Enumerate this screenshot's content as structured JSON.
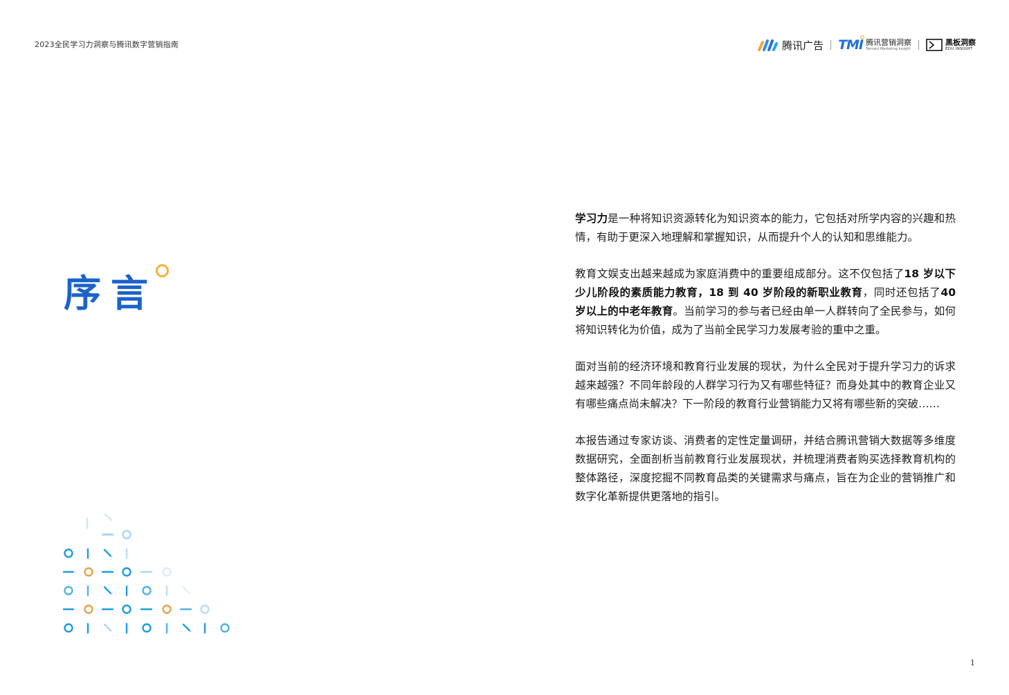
{
  "header": {
    "document_title": "2023全民学习力洞察与腾讯数字营销指南",
    "logos": {
      "tencent_ads": "腾讯广告",
      "tmi_mark": "TMI",
      "tmi_cn": "腾讯营销洞察",
      "tmi_en": "Tencent Marketing Insight",
      "heiban_cn": "黑板洞察",
      "heiban_en": "EDU INSIGHT"
    }
  },
  "page_title": "序言",
  "paragraphs": {
    "p1": {
      "b1": "学习力",
      "t1": "是一种将知识资源转化为知识资本的能力，它包括对所学内容的兴趣和热情，有助于更深入地理解和掌握知识，从而提升个人的认知和思维能力。"
    },
    "p2": {
      "t1": "教育文娱支出越来越成为家庭消费中的重要组成部分。这不仅包括了",
      "b1": "18 岁以下少儿阶段的素质能力教育，18 到 40 岁阶段的新职业教育",
      "t2": "，同时还包括了",
      "b2": "40 岁以上的中老年教育",
      "t3": "。当前学习的参与者已经由单一人群转向了全民参与，如何将知识转化为价值，成为了当前全民学习力发展考验的重中之重。"
    },
    "p3": {
      "t1": "面对当前的经济环境和教育行业发展的现状，为什么全民对于提升学习力的诉求越来越强？不同年龄段的人群学习行为又有哪些特征？而身处其中的教育企业又有哪些痛点尚未解决？下一阶段的教育行业营销能力又将有哪些新的突破……"
    },
    "p4": {
      "t1": "本报告通过专家访谈、消费者的定性定量调研，并结合腾讯营销大数据等多维度数据研究，全面剖析当前教育行业发展现状，并梳理消费者购买选择教育机构的整体路径，深度挖掘不同教育品类的关键需求与痛点，旨在为企业的营销推广和数字化革新提供更落地的指引。"
    }
  },
  "page_number": "1",
  "colors": {
    "title_blue": "#1c63c9",
    "accent_orange": "#f2b13c",
    "deco_blue": "#2a9de0",
    "deco_orange": "#e8a24a"
  }
}
